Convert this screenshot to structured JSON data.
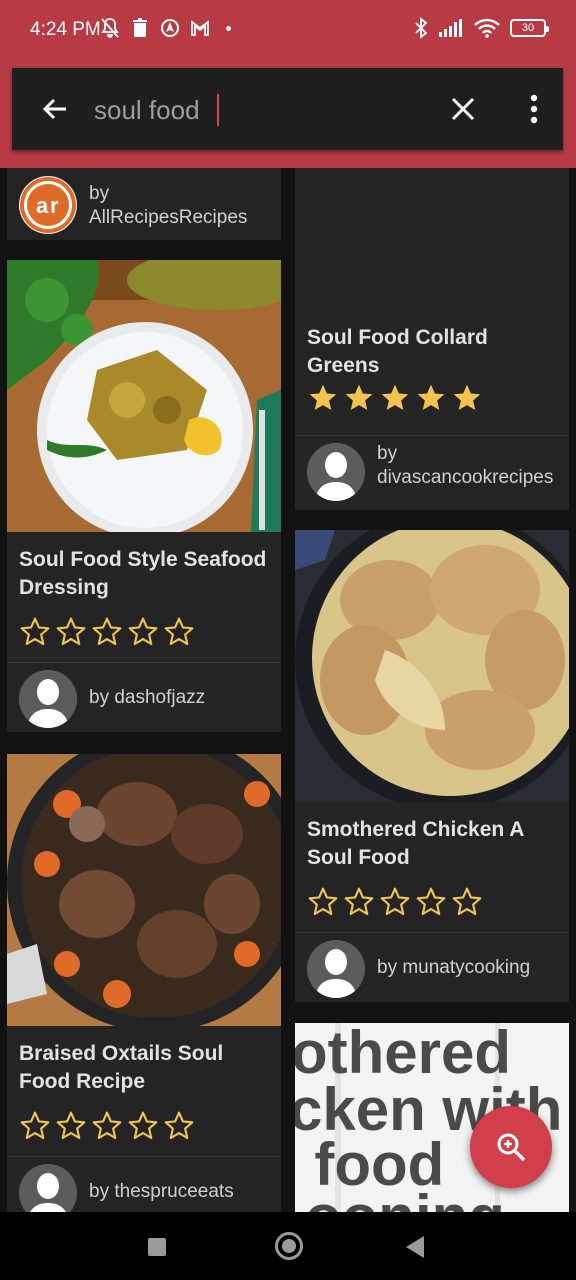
{
  "status_bar": {
    "time": "4:24 PM",
    "battery": "30"
  },
  "search": {
    "query": "soul food",
    "placeholder": ""
  },
  "recipes": [
    {
      "title": "",
      "author": "by AllRecipesRecipes",
      "rating": null
    },
    {
      "title": "Soul Food Collard Greens",
      "author": "by divascancookrecipes",
      "rating": 5
    },
    {
      "title": "Soul Food Style Seafood Dressing",
      "author": "by dashofjazz",
      "rating": 0
    },
    {
      "title": "Smothered Chicken A Soul Food",
      "author": "by munatycooking",
      "rating": 0
    },
    {
      "title": "Braised Oxtails Soul Food Recipe",
      "author": "by thespruceeats",
      "rating": 0
    }
  ],
  "image_text": {
    "partial_title_image": [
      "othered",
      "cken with",
      "l food",
      "ooning"
    ]
  },
  "colors": {
    "primary": "#b73a45",
    "fab": "#d23e4b",
    "star": "#f1c44f",
    "card": "#242424",
    "background": "#121212"
  }
}
